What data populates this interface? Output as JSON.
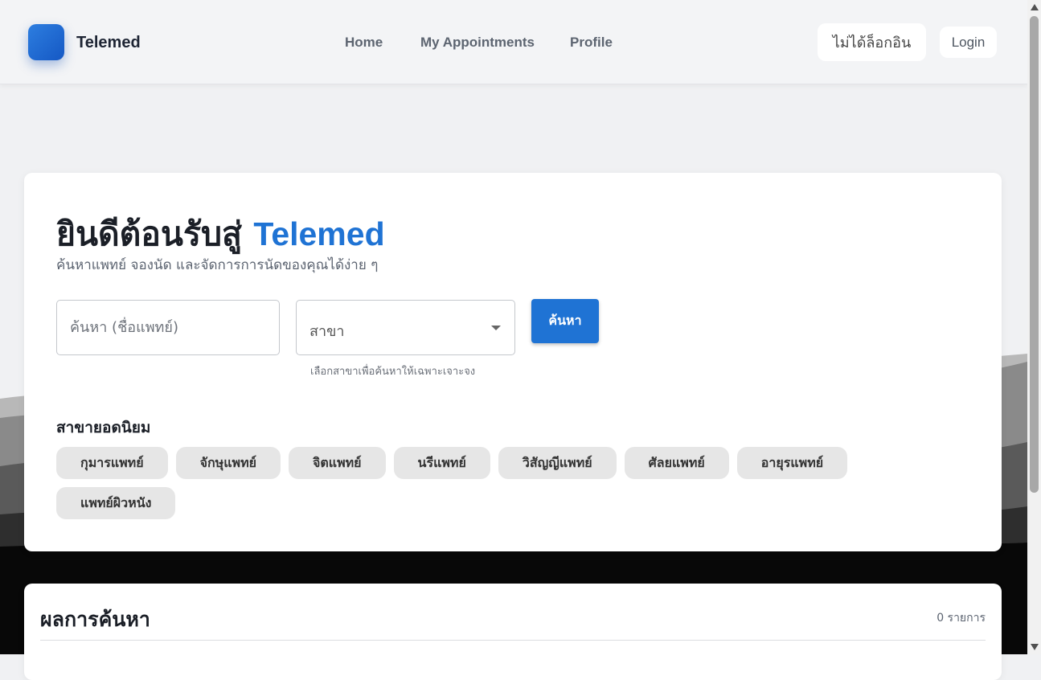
{
  "colors": {
    "accent": "#1f73d4",
    "chip_bg": "#e6e6e6",
    "page_bg": "#f0f1f3"
  },
  "navbar": {
    "brand": "Telemed",
    "logo_icon": "app-logo-icon",
    "links": [
      {
        "label": "Home"
      },
      {
        "label": "My Appointments"
      },
      {
        "label": "Profile"
      }
    ],
    "status": "ไม่ได้ล็อกอิน",
    "login": "Login"
  },
  "hero": {
    "title_prefix": "ยินดีต้อนรับสู่",
    "title_accent": "Telemed",
    "subtitle": "ค้นหาแพทย์ จองนัด และจัดการการนัดของคุณได้ง่าย ๆ",
    "search_placeholder": "ค้นหา (ชื่อแพทย์)",
    "specialty_label": "สาขา",
    "specialty_helper": "เลือกสาขาเพื่อค้นหาให้เฉพาะเจาะจง",
    "search_button": "ค้นหา",
    "popular_title": "สาขายอดนิยม",
    "chips": [
      "กุมารแพทย์",
      "จักษุแพทย์",
      "จิตแพทย์",
      "นรีแพทย์",
      "วิสัญญีแพทย์",
      "ศัลยแพทย์",
      "อายุรแพทย์",
      "แพทย์ผิวหนัง"
    ]
  },
  "results": {
    "title": "ผลการค้นหา",
    "count": "0 รายการ"
  }
}
